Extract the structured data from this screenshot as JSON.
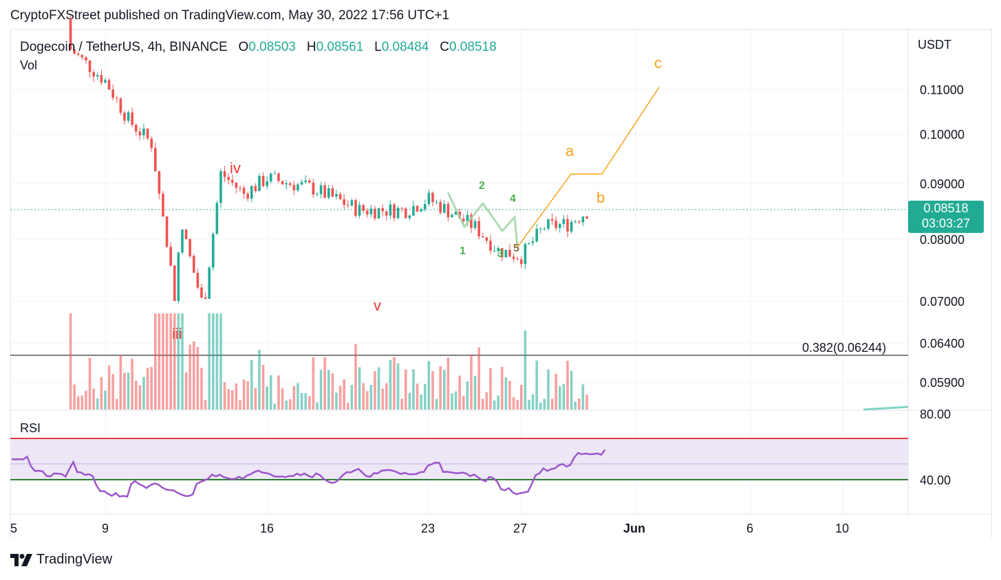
{
  "header": {
    "publish_line": "CryptoFXStreet published on TradingView.com, May 30, 2022 17:56 UTC+1"
  },
  "legend": {
    "symbol": "Dogecoin / TetherUS, 4h, BINANCE",
    "open_label": "O",
    "open": "0.08503",
    "high_label": "H",
    "high": "0.08561",
    "low_label": "L",
    "low": "0.08484",
    "close_label": "C",
    "close": "0.08518"
  },
  "panes": {
    "volume_label": "Vol",
    "rsi_label": "RSI"
  },
  "price_axis": {
    "currency": "USDT",
    "ticks": [
      "0.11000",
      "0.10000",
      "0.09000",
      "0.08000",
      "0.07000",
      "0.06400",
      "0.05900"
    ]
  },
  "rsi_axis": {
    "ticks": [
      "80.00",
      "40.00"
    ]
  },
  "time_axis": {
    "ticks": [
      "5",
      "9",
      "16",
      "23",
      "27",
      "Jun",
      "6",
      "10"
    ]
  },
  "last_price": {
    "price": "0.08518",
    "countdown": "03:03:27"
  },
  "fib_level": {
    "label": "0.382(0.06244)"
  },
  "wave_labels": {
    "impulse": [
      "iii",
      "iv",
      "v"
    ],
    "minor": [
      "1",
      "2",
      "3",
      "4",
      "5"
    ],
    "corrective": [
      "a",
      "b",
      "c"
    ]
  },
  "footer": {
    "brand": "TradingView"
  },
  "colors": {
    "up": "#22ab94",
    "down": "#ef5350",
    "wave_red": "#e53935",
    "wave_green": "#4caf50",
    "wave_orange": "#f7a21b",
    "rsi_line": "#9c55c9",
    "rsi_upper": "#e53940",
    "rsi_lower": "#2e7d32",
    "rsi_band": "#ede7f6"
  },
  "chart_data": {
    "type": "candlestick",
    "title": "Dogecoin / TetherUS, 4h, BINANCE",
    "y_scale": "log",
    "ylim": [
      0.0555,
      0.121
    ],
    "x_dates": [
      "May 5",
      "May 9",
      "May 16",
      "May 23",
      "May 27",
      "Jun",
      "Jun 6",
      "Jun 10"
    ],
    "price_path": [
      {
        "date": "May 6",
        "price": 0.128
      },
      {
        "date": "May 9",
        "price": 0.112
      },
      {
        "date": "May 10",
        "price": 0.103
      },
      {
        "date": "May 11",
        "price": 0.098
      },
      {
        "date": "May 12",
        "price": 0.071
      },
      {
        "date": "May 12",
        "price": 0.082
      },
      {
        "date": "May 13",
        "price": 0.069
      },
      {
        "date": "May 14",
        "price": 0.092
      },
      {
        "date": "May 15",
        "price": 0.088
      },
      {
        "date": "May 16",
        "price": 0.091
      },
      {
        "date": "May 18",
        "price": 0.089
      },
      {
        "date": "May 20",
        "price": 0.085
      },
      {
        "date": "May 22",
        "price": 0.085
      },
      {
        "date": "May 23",
        "price": 0.087
      },
      {
        "date": "May 25",
        "price": 0.082
      },
      {
        "date": "May 26",
        "price": 0.078
      },
      {
        "date": "May 27",
        "price": 0.077
      },
      {
        "date": "May 28",
        "price": 0.082
      },
      {
        "date": "May 29",
        "price": 0.0825
      },
      {
        "date": "May 30",
        "price": 0.08518
      }
    ],
    "wave_projection": [
      {
        "label": "start",
        "date": "May 27",
        "price": 0.0785
      },
      {
        "label": "a",
        "date": "May 29",
        "price": 0.0918
      },
      {
        "label": "b",
        "date": "May 30",
        "price": 0.0918
      },
      {
        "label": "c",
        "date": "Jun 2",
        "price": 0.1105
      }
    ],
    "fibonacci": {
      "ratio": 0.382,
      "price": 0.06244
    },
    "last_close": 0.08518,
    "rsi": {
      "upper": 80,
      "lower": 40,
      "last": 69
    }
  }
}
